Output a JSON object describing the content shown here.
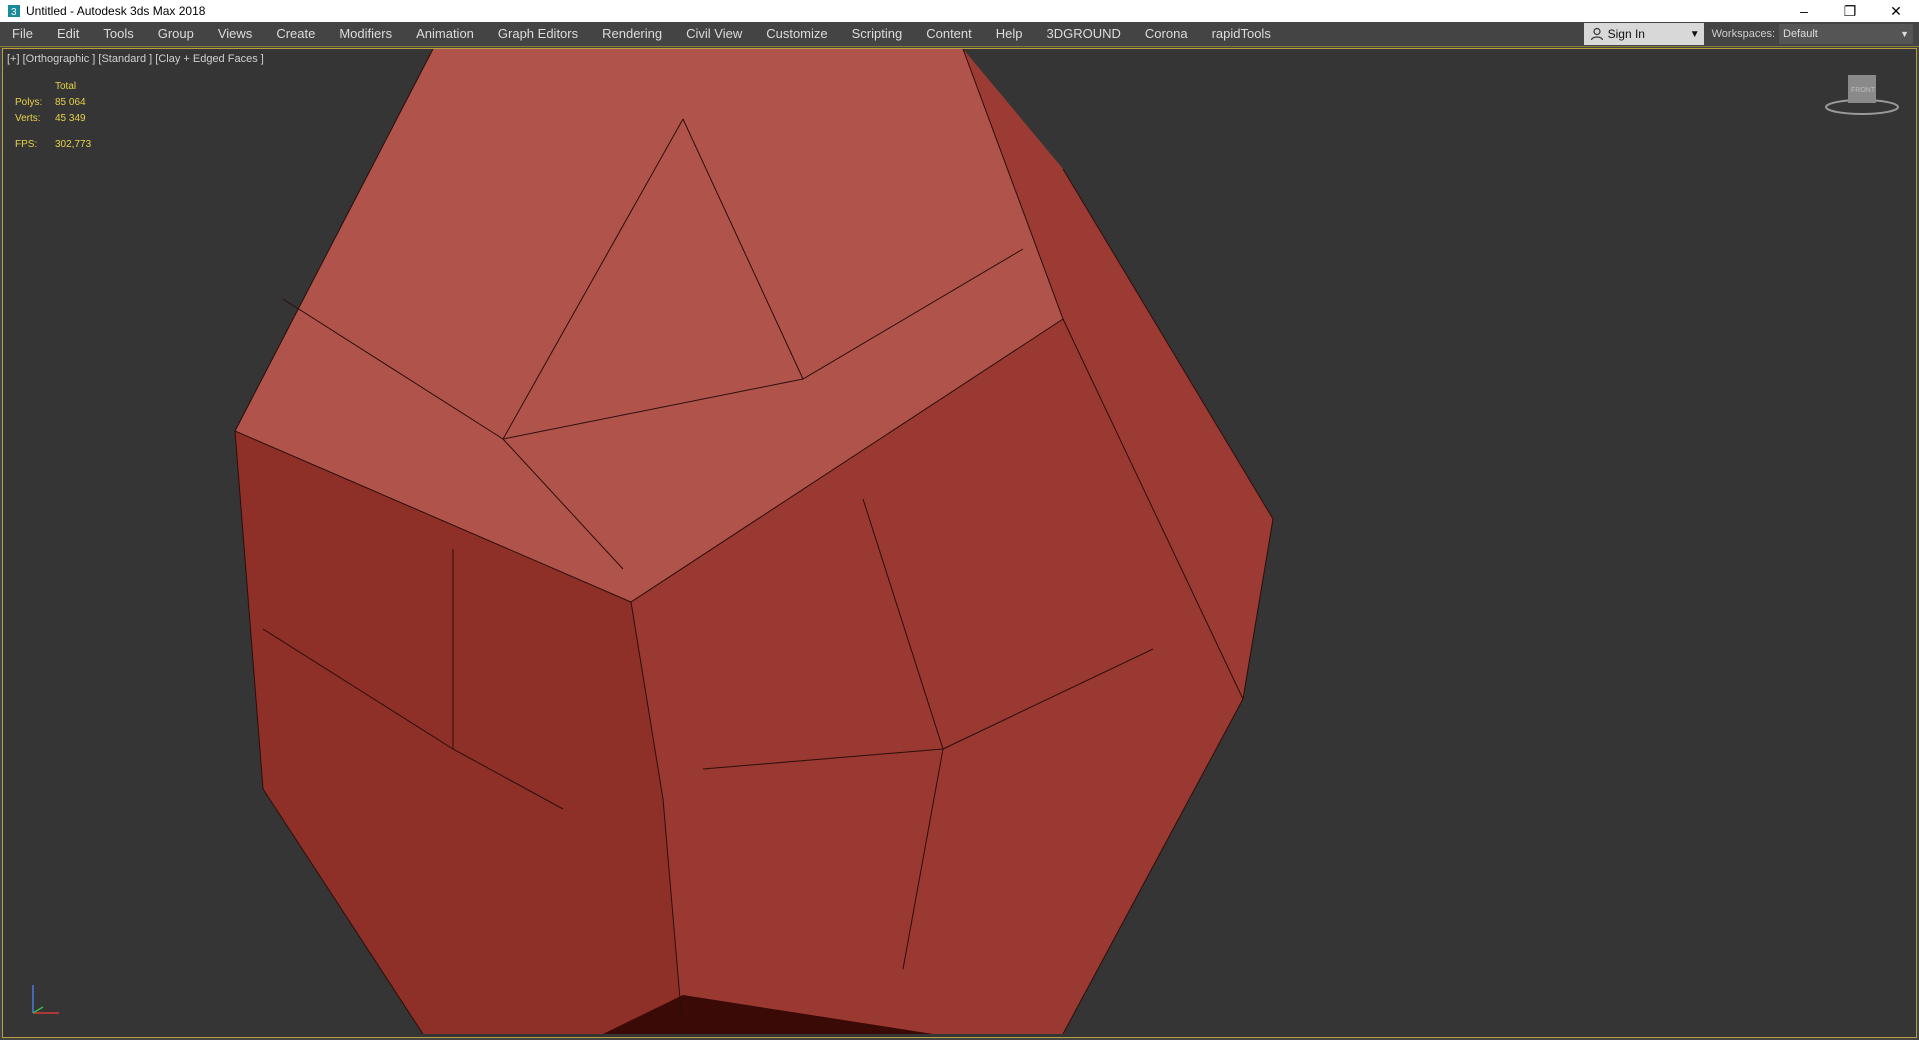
{
  "window": {
    "title": "Untitled - Autodesk 3ds Max 2018",
    "minimize_icon": "minimize-icon",
    "restore_icon": "restore-icon",
    "close_icon": "close-icon"
  },
  "menu": {
    "items": [
      "File",
      "Edit",
      "Tools",
      "Group",
      "Views",
      "Create",
      "Modifiers",
      "Animation",
      "Graph Editors",
      "Rendering",
      "Civil View",
      "Customize",
      "Scripting",
      "Content",
      "Help",
      "3DGROUND",
      "Corona",
      "rapidTools"
    ],
    "sign_in": "Sign In",
    "workspaces_label": "Workspaces:",
    "workspace_value": "Default"
  },
  "viewport": {
    "label": "[+] [Orthographic ] [Standard ] [Clay + Edged Faces ]",
    "stats_header": "Total",
    "polys_label": "Polys:",
    "polys_value": "85 064",
    "verts_label": "Verts:",
    "verts_value": "45 349",
    "fps_label": "FPS:",
    "fps_value": "302,773",
    "viewcube_label": "FRONT"
  },
  "colors": {
    "viewport_bg": "#353535",
    "mesh": "#a5473f",
    "stats_text": "#e7d34a"
  }
}
